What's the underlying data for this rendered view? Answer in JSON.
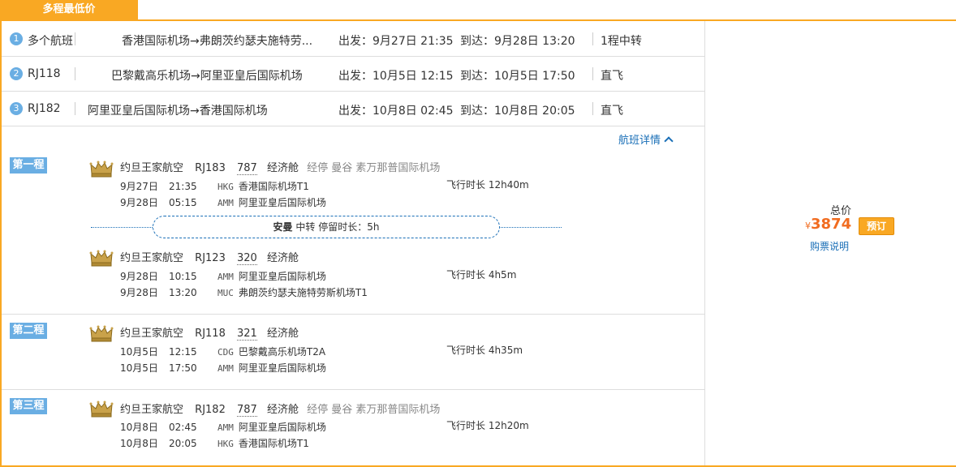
{
  "tab_label": "多程最低价",
  "summary": [
    {
      "num": "1",
      "flight": "多个航班",
      "route": "香港国际机场→弗朗茨约瑟夫施特劳...",
      "dep": "出发：9月27日 21:35",
      "arr": "到达：9月28日 13:20",
      "stop": "1程中转"
    },
    {
      "num": "2",
      "flight": "RJ118",
      "route": "巴黎戴高乐机场→阿里亚皇后国际机场",
      "dep": "出发：10月5日 12:15",
      "arr": "到达：10月5日 17:50",
      "stop": "直飞"
    },
    {
      "num": "3",
      "flight": "RJ182",
      "route": "阿里亚皇后国际机场→香港国际机场",
      "dep": "出发：10月8日 02:45",
      "arr": "到达：10月8日 20:05",
      "stop": "直飞"
    }
  ],
  "details_link": "航班详情",
  "legs": [
    {
      "label": "第一程",
      "segments": [
        {
          "airline": "约旦王家航空",
          "flight": "RJ183",
          "aircraft": "787",
          "cabin": "经济舱",
          "via": "经停 曼谷 素万那普国际机场",
          "dep_date": "9月27日",
          "dep_time": "21:35",
          "dep_code": "HKG",
          "dep_airport": "香港国际机场T1",
          "arr_date": "9月28日",
          "arr_time": "05:15",
          "arr_code": "AMM",
          "arr_airport": "阿里亚皇后国际机场",
          "duration": "飞行时长 12h40m"
        },
        {
          "airline": "约旦王家航空",
          "flight": "RJ123",
          "aircraft": "320",
          "cabin": "经济舱",
          "via": "",
          "dep_date": "9月28日",
          "dep_time": "10:15",
          "dep_code": "AMM",
          "dep_airport": "阿里亚皇后国际机场",
          "arr_date": "9月28日",
          "arr_time": "13:20",
          "arr_code": "MUC",
          "arr_airport": "弗朗茨约瑟夫施特劳斯机场T1",
          "duration": "飞行时长 4h5m"
        }
      ],
      "layover": {
        "city": "安曼",
        "text": " 中转  停留时长：5h"
      }
    },
    {
      "label": "第二程",
      "segments": [
        {
          "airline": "约旦王家航空",
          "flight": "RJ118",
          "aircraft": "321",
          "cabin": "经济舱",
          "via": "",
          "dep_date": "10月5日",
          "dep_time": "12:15",
          "dep_code": "CDG",
          "dep_airport": "巴黎戴高乐机场T2A",
          "arr_date": "10月5日",
          "arr_time": "17:50",
          "arr_code": "AMM",
          "arr_airport": "阿里亚皇后国际机场",
          "duration": "飞行时长 4h35m"
        }
      ]
    },
    {
      "label": "第三程",
      "segments": [
        {
          "airline": "约旦王家航空",
          "flight": "RJ182",
          "aircraft": "787",
          "cabin": "经济舱",
          "via": "经停 曼谷 素万那普国际机场",
          "dep_date": "10月8日",
          "dep_time": "02:45",
          "dep_code": "AMM",
          "dep_airport": "阿里亚皇后国际机场",
          "arr_date": "10月8日",
          "arr_time": "20:05",
          "arr_code": "HKG",
          "arr_airport": "香港国际机场T1",
          "duration": "飞行时长 12h20m"
        }
      ]
    }
  ],
  "price": {
    "label": "总价",
    "currency": "¥",
    "amount": "3874",
    "book_label": "预订",
    "rules_link": "购票说明"
  },
  "colors": {
    "accent": "#f9a823",
    "badge": "#6aaee3",
    "link": "#1a6fb7",
    "price": "#f16c20"
  }
}
